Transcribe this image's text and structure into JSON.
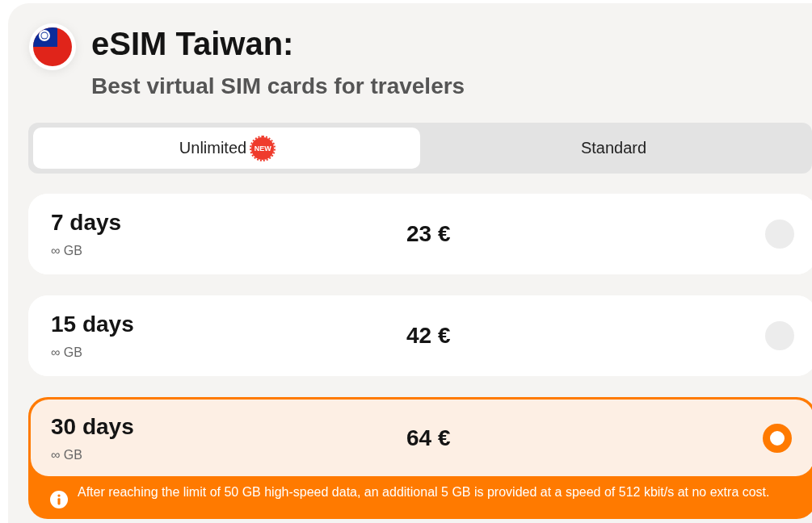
{
  "header": {
    "title": "eSIM Taiwan:",
    "subtitle": "Best virtual SIM cards for travelers"
  },
  "tabs": [
    {
      "label": "Unlimited",
      "badge": "NEW",
      "selected": true
    },
    {
      "label": "Standard",
      "selected": false
    }
  ],
  "plans": [
    {
      "duration": "7 days",
      "data": "∞ GB",
      "price": "23 €",
      "selected": false
    },
    {
      "duration": "15 days",
      "data": "∞ GB",
      "price": "42 €",
      "selected": false
    },
    {
      "duration": "30 days",
      "data": "∞ GB",
      "price": "64 €",
      "selected": true,
      "note": "After reaching the limit of 50 GB high-speed data, an additional 5 GB is provided at a speed of 512 kbit/s at no extra cost."
    }
  ]
}
